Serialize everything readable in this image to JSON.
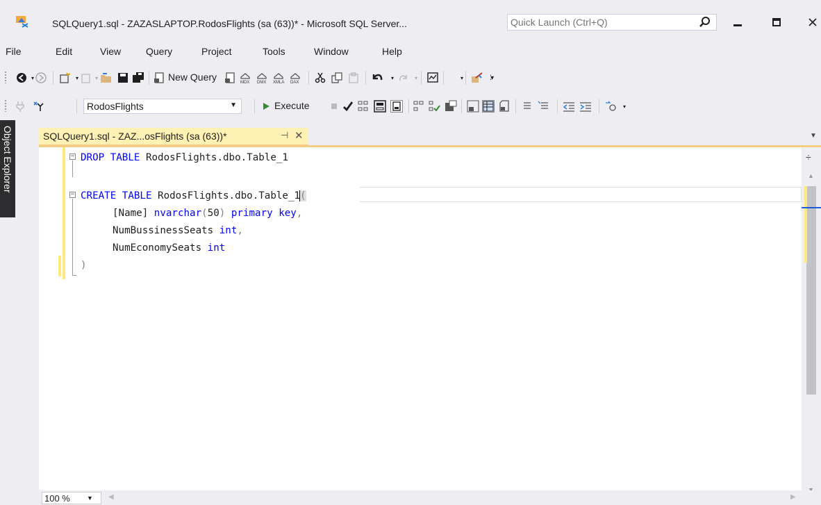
{
  "window": {
    "title": "SQLQuery1.sql - ZAZASLAPTOP.RodosFlights (sa (63))* - Microsoft SQL Server...",
    "quick_launch_placeholder": "Quick Launch (Ctrl+Q)"
  },
  "menu": [
    "File",
    "Edit",
    "View",
    "Query",
    "Project",
    "Tools",
    "Window",
    "Help"
  ],
  "toolbar": {
    "new_query_label": "New Query",
    "database": "RodosFlights",
    "execute_label": "Execute"
  },
  "side_panel": {
    "object_explorer_label": "Object Explorer"
  },
  "document_tab": {
    "label": "SQLQuery1.sql - ZAZ...osFlights (sa (63))*"
  },
  "code": {
    "line1_kw": "DROP TABLE ",
    "line1_rest": "RodosFlights.dbo.Table_1",
    "line3_kw": "CREATE TABLE ",
    "line3_rest": "RodosFlights.dbo.Table_1",
    "line3_paren": "(",
    "line4_a": "[Name] ",
    "line4_b": "nvarchar",
    "line4_c": "(",
    "line4_d": "50",
    "line4_e": ") ",
    "line4_f": "primary key",
    "line4_g": ",",
    "line5_a": "NumBussinessSeats ",
    "line5_b": "int",
    "line5_c": ",",
    "line6_a": "NumEconomySeats ",
    "line6_b": "int",
    "line7": ")"
  },
  "status": {
    "zoom": "100 %"
  },
  "colors": {
    "keyword": "#0000ff",
    "punctuation": "#808080",
    "changed_marker": "#ffe87c",
    "tab_active": "#fff1b3"
  }
}
